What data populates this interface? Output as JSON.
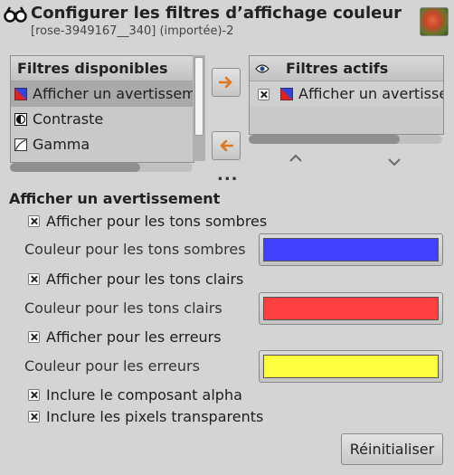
{
  "window": {
    "title": "Configurer les filtres d’affichage couleur",
    "subtitle": "[rose-3949167__340] (importée)-2"
  },
  "available": {
    "header": "Filtres disponibles",
    "items": [
      {
        "label": "Afficher un avertissement",
        "icon": "clip-warning-icon",
        "selected": true
      },
      {
        "label": "Contraste",
        "icon": "contrast-icon",
        "selected": false
      },
      {
        "label": "Gamma",
        "icon": "gamma-curve-icon",
        "selected": false
      }
    ]
  },
  "active": {
    "header": "Filtres actifs",
    "items": [
      {
        "label": "Afficher un avertissement",
        "icon": "clip-warning-icon",
        "enabled": true
      }
    ]
  },
  "settings": {
    "title": "Afficher un avertissement",
    "dark_check": "Afficher pour les tons sombres",
    "dark_color_label": "Couleur pour les tons sombres",
    "dark_color": "#4040ff",
    "light_check": "Afficher pour les tons clairs",
    "light_color_label": "Couleur pour les tons clairs",
    "light_color": "#ff4040",
    "error_check": "Afficher pour les erreurs",
    "error_color_label": "Couleur pour les erreurs",
    "error_color": "#ffff40",
    "alpha_check": "Inclure le composant alpha",
    "transparent_check": "Inclure les pixels transparents"
  },
  "buttons": {
    "reset": "Réinitialiser",
    "more": "..."
  },
  "colors": {
    "accent_arrow": "#e0761e"
  }
}
